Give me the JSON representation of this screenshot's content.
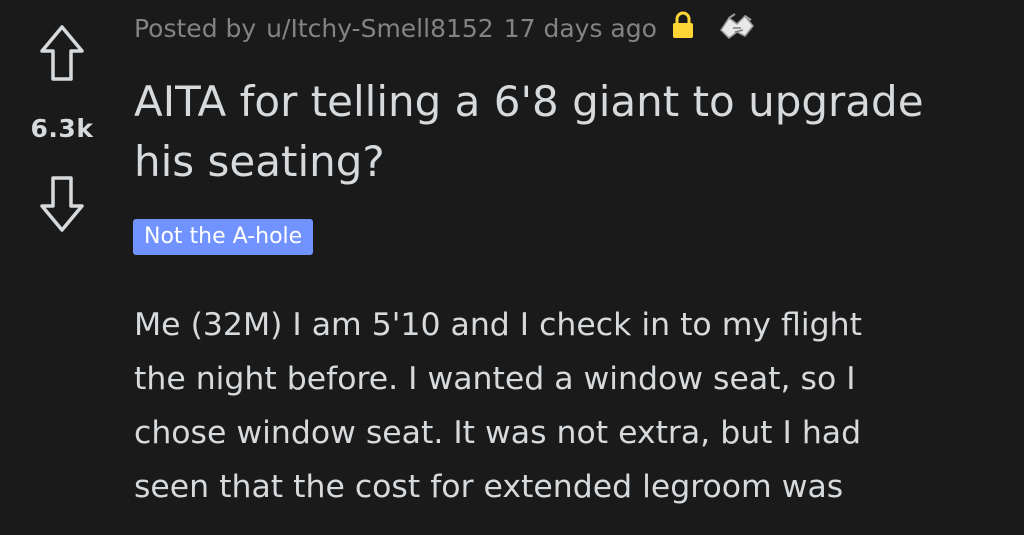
{
  "post": {
    "score": "6.3k",
    "meta": {
      "posted_by_prefix": "Posted by",
      "author": "u/Itchy-Smell8152",
      "age": "17 days ago"
    },
    "title_line1": "AITA for telling a 6'8 giant to upgrade",
    "title_line2": "his seating?",
    "flair": "Not the A-hole",
    "body_lines": [
      "Me (32M) I am 5'10 and I check in to my flight",
      "the night before. I wanted a window seat, so I",
      "chose window seat. It was not extra, but I had",
      "seen that the cost for extended legroom was"
    ],
    "icons": {
      "upvote": "upvote-arrow-icon",
      "downvote": "downvote-arrow-icon",
      "lock": "lock-icon",
      "award": "handshake-award-icon"
    },
    "colors": {
      "background": "#1a1a1b",
      "text": "#d7dadc",
      "meta": "#818384",
      "flair_bg": "#7193ff",
      "lock": "#ffd635"
    }
  }
}
